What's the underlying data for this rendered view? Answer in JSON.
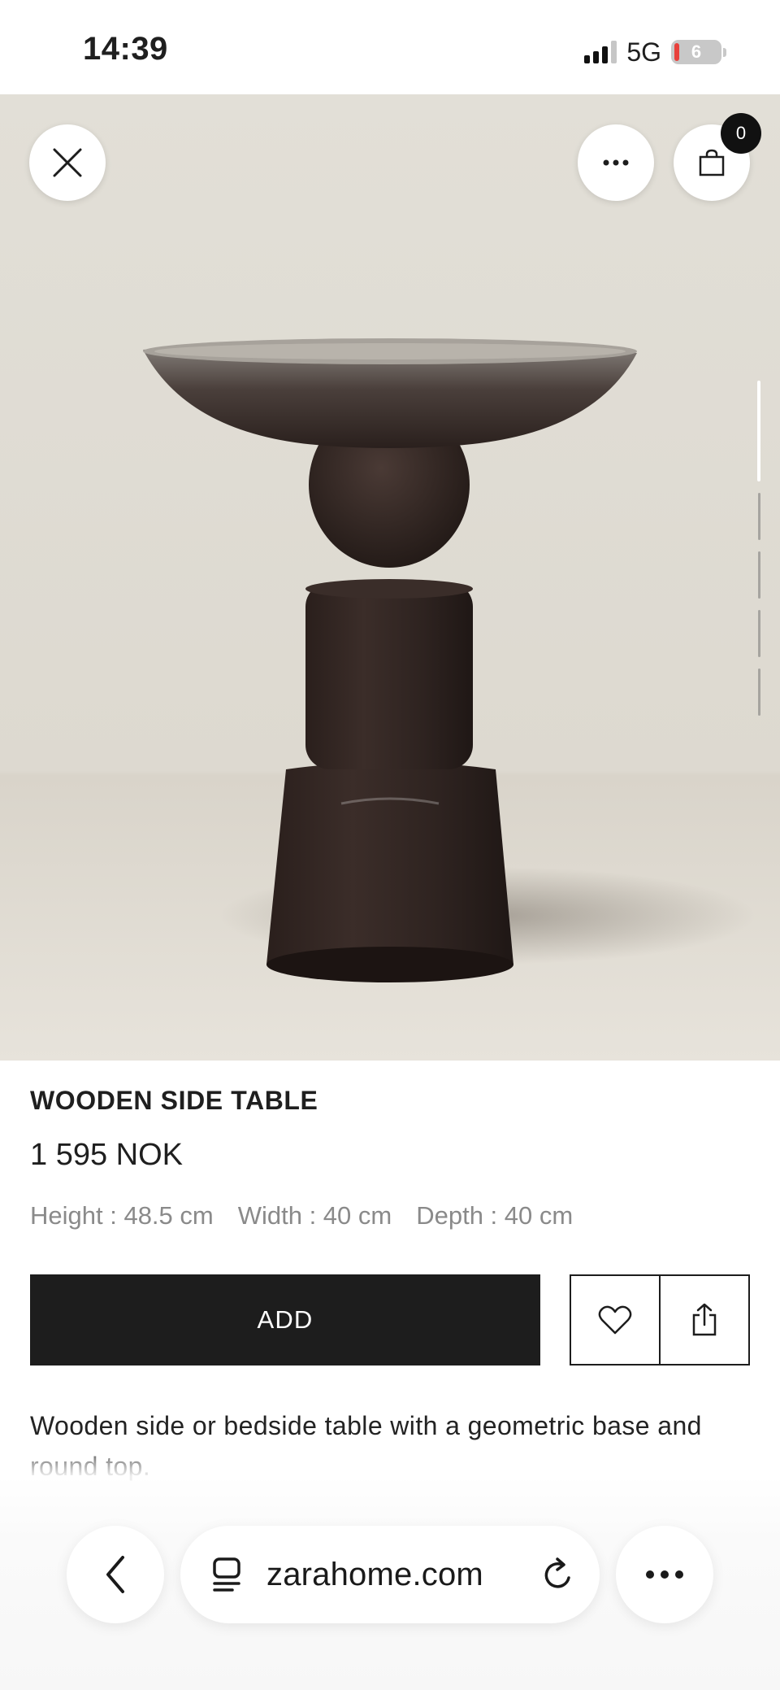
{
  "status_bar": {
    "time": "14:39",
    "network": "5G",
    "battery": "6"
  },
  "header": {
    "cart_count": "0"
  },
  "product": {
    "title": "WOODEN SIDE TABLE",
    "price": "1 595 NOK",
    "dimensions": [
      "Height : 48.5 cm",
      "Width : 40 cm",
      "Depth : 40 cm"
    ],
    "add_label": "ADD",
    "description": "Wooden side or bedside table with a geometric base and round top."
  },
  "browser": {
    "url": "zarahome.com"
  },
  "icons": {
    "close": "close-icon",
    "more": "more-icon",
    "bag": "shopping-bag-icon",
    "wishlist": "heart-icon",
    "share": "share-icon",
    "back": "chevron-left-icon",
    "tabs": "tab-overview-icon",
    "reload": "reload-icon",
    "browser_more": "more-icon"
  },
  "colors": {
    "primary": "#1d1d1d",
    "badge": "#111111",
    "battery_low": "#e8413c"
  }
}
